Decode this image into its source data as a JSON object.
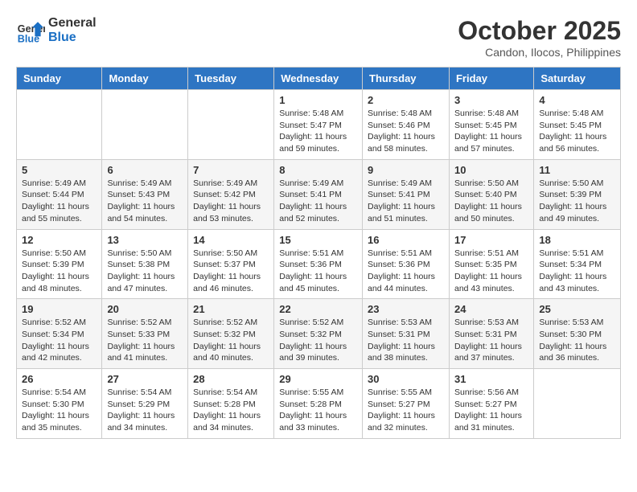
{
  "header": {
    "logo_line1": "General",
    "logo_line2": "Blue",
    "month": "October 2025",
    "location": "Candon, Ilocos, Philippines"
  },
  "weekdays": [
    "Sunday",
    "Monday",
    "Tuesday",
    "Wednesday",
    "Thursday",
    "Friday",
    "Saturday"
  ],
  "weeks": [
    [
      {
        "day": "",
        "info": ""
      },
      {
        "day": "",
        "info": ""
      },
      {
        "day": "",
        "info": ""
      },
      {
        "day": "1",
        "info": "Sunrise: 5:48 AM\nSunset: 5:47 PM\nDaylight: 11 hours\nand 59 minutes."
      },
      {
        "day": "2",
        "info": "Sunrise: 5:48 AM\nSunset: 5:46 PM\nDaylight: 11 hours\nand 58 minutes."
      },
      {
        "day": "3",
        "info": "Sunrise: 5:48 AM\nSunset: 5:45 PM\nDaylight: 11 hours\nand 57 minutes."
      },
      {
        "day": "4",
        "info": "Sunrise: 5:48 AM\nSunset: 5:45 PM\nDaylight: 11 hours\nand 56 minutes."
      }
    ],
    [
      {
        "day": "5",
        "info": "Sunrise: 5:49 AM\nSunset: 5:44 PM\nDaylight: 11 hours\nand 55 minutes."
      },
      {
        "day": "6",
        "info": "Sunrise: 5:49 AM\nSunset: 5:43 PM\nDaylight: 11 hours\nand 54 minutes."
      },
      {
        "day": "7",
        "info": "Sunrise: 5:49 AM\nSunset: 5:42 PM\nDaylight: 11 hours\nand 53 minutes."
      },
      {
        "day": "8",
        "info": "Sunrise: 5:49 AM\nSunset: 5:41 PM\nDaylight: 11 hours\nand 52 minutes."
      },
      {
        "day": "9",
        "info": "Sunrise: 5:49 AM\nSunset: 5:41 PM\nDaylight: 11 hours\nand 51 minutes."
      },
      {
        "day": "10",
        "info": "Sunrise: 5:50 AM\nSunset: 5:40 PM\nDaylight: 11 hours\nand 50 minutes."
      },
      {
        "day": "11",
        "info": "Sunrise: 5:50 AM\nSunset: 5:39 PM\nDaylight: 11 hours\nand 49 minutes."
      }
    ],
    [
      {
        "day": "12",
        "info": "Sunrise: 5:50 AM\nSunset: 5:39 PM\nDaylight: 11 hours\nand 48 minutes."
      },
      {
        "day": "13",
        "info": "Sunrise: 5:50 AM\nSunset: 5:38 PM\nDaylight: 11 hours\nand 47 minutes."
      },
      {
        "day": "14",
        "info": "Sunrise: 5:50 AM\nSunset: 5:37 PM\nDaylight: 11 hours\nand 46 minutes."
      },
      {
        "day": "15",
        "info": "Sunrise: 5:51 AM\nSunset: 5:36 PM\nDaylight: 11 hours\nand 45 minutes."
      },
      {
        "day": "16",
        "info": "Sunrise: 5:51 AM\nSunset: 5:36 PM\nDaylight: 11 hours\nand 44 minutes."
      },
      {
        "day": "17",
        "info": "Sunrise: 5:51 AM\nSunset: 5:35 PM\nDaylight: 11 hours\nand 43 minutes."
      },
      {
        "day": "18",
        "info": "Sunrise: 5:51 AM\nSunset: 5:34 PM\nDaylight: 11 hours\nand 43 minutes."
      }
    ],
    [
      {
        "day": "19",
        "info": "Sunrise: 5:52 AM\nSunset: 5:34 PM\nDaylight: 11 hours\nand 42 minutes."
      },
      {
        "day": "20",
        "info": "Sunrise: 5:52 AM\nSunset: 5:33 PM\nDaylight: 11 hours\nand 41 minutes."
      },
      {
        "day": "21",
        "info": "Sunrise: 5:52 AM\nSunset: 5:32 PM\nDaylight: 11 hours\nand 40 minutes."
      },
      {
        "day": "22",
        "info": "Sunrise: 5:52 AM\nSunset: 5:32 PM\nDaylight: 11 hours\nand 39 minutes."
      },
      {
        "day": "23",
        "info": "Sunrise: 5:53 AM\nSunset: 5:31 PM\nDaylight: 11 hours\nand 38 minutes."
      },
      {
        "day": "24",
        "info": "Sunrise: 5:53 AM\nSunset: 5:31 PM\nDaylight: 11 hours\nand 37 minutes."
      },
      {
        "day": "25",
        "info": "Sunrise: 5:53 AM\nSunset: 5:30 PM\nDaylight: 11 hours\nand 36 minutes."
      }
    ],
    [
      {
        "day": "26",
        "info": "Sunrise: 5:54 AM\nSunset: 5:30 PM\nDaylight: 11 hours\nand 35 minutes."
      },
      {
        "day": "27",
        "info": "Sunrise: 5:54 AM\nSunset: 5:29 PM\nDaylight: 11 hours\nand 34 minutes."
      },
      {
        "day": "28",
        "info": "Sunrise: 5:54 AM\nSunset: 5:28 PM\nDaylight: 11 hours\nand 34 minutes."
      },
      {
        "day": "29",
        "info": "Sunrise: 5:55 AM\nSunset: 5:28 PM\nDaylight: 11 hours\nand 33 minutes."
      },
      {
        "day": "30",
        "info": "Sunrise: 5:55 AM\nSunset: 5:27 PM\nDaylight: 11 hours\nand 32 minutes."
      },
      {
        "day": "31",
        "info": "Sunrise: 5:56 AM\nSunset: 5:27 PM\nDaylight: 11 hours\nand 31 minutes."
      },
      {
        "day": "",
        "info": ""
      }
    ]
  ]
}
